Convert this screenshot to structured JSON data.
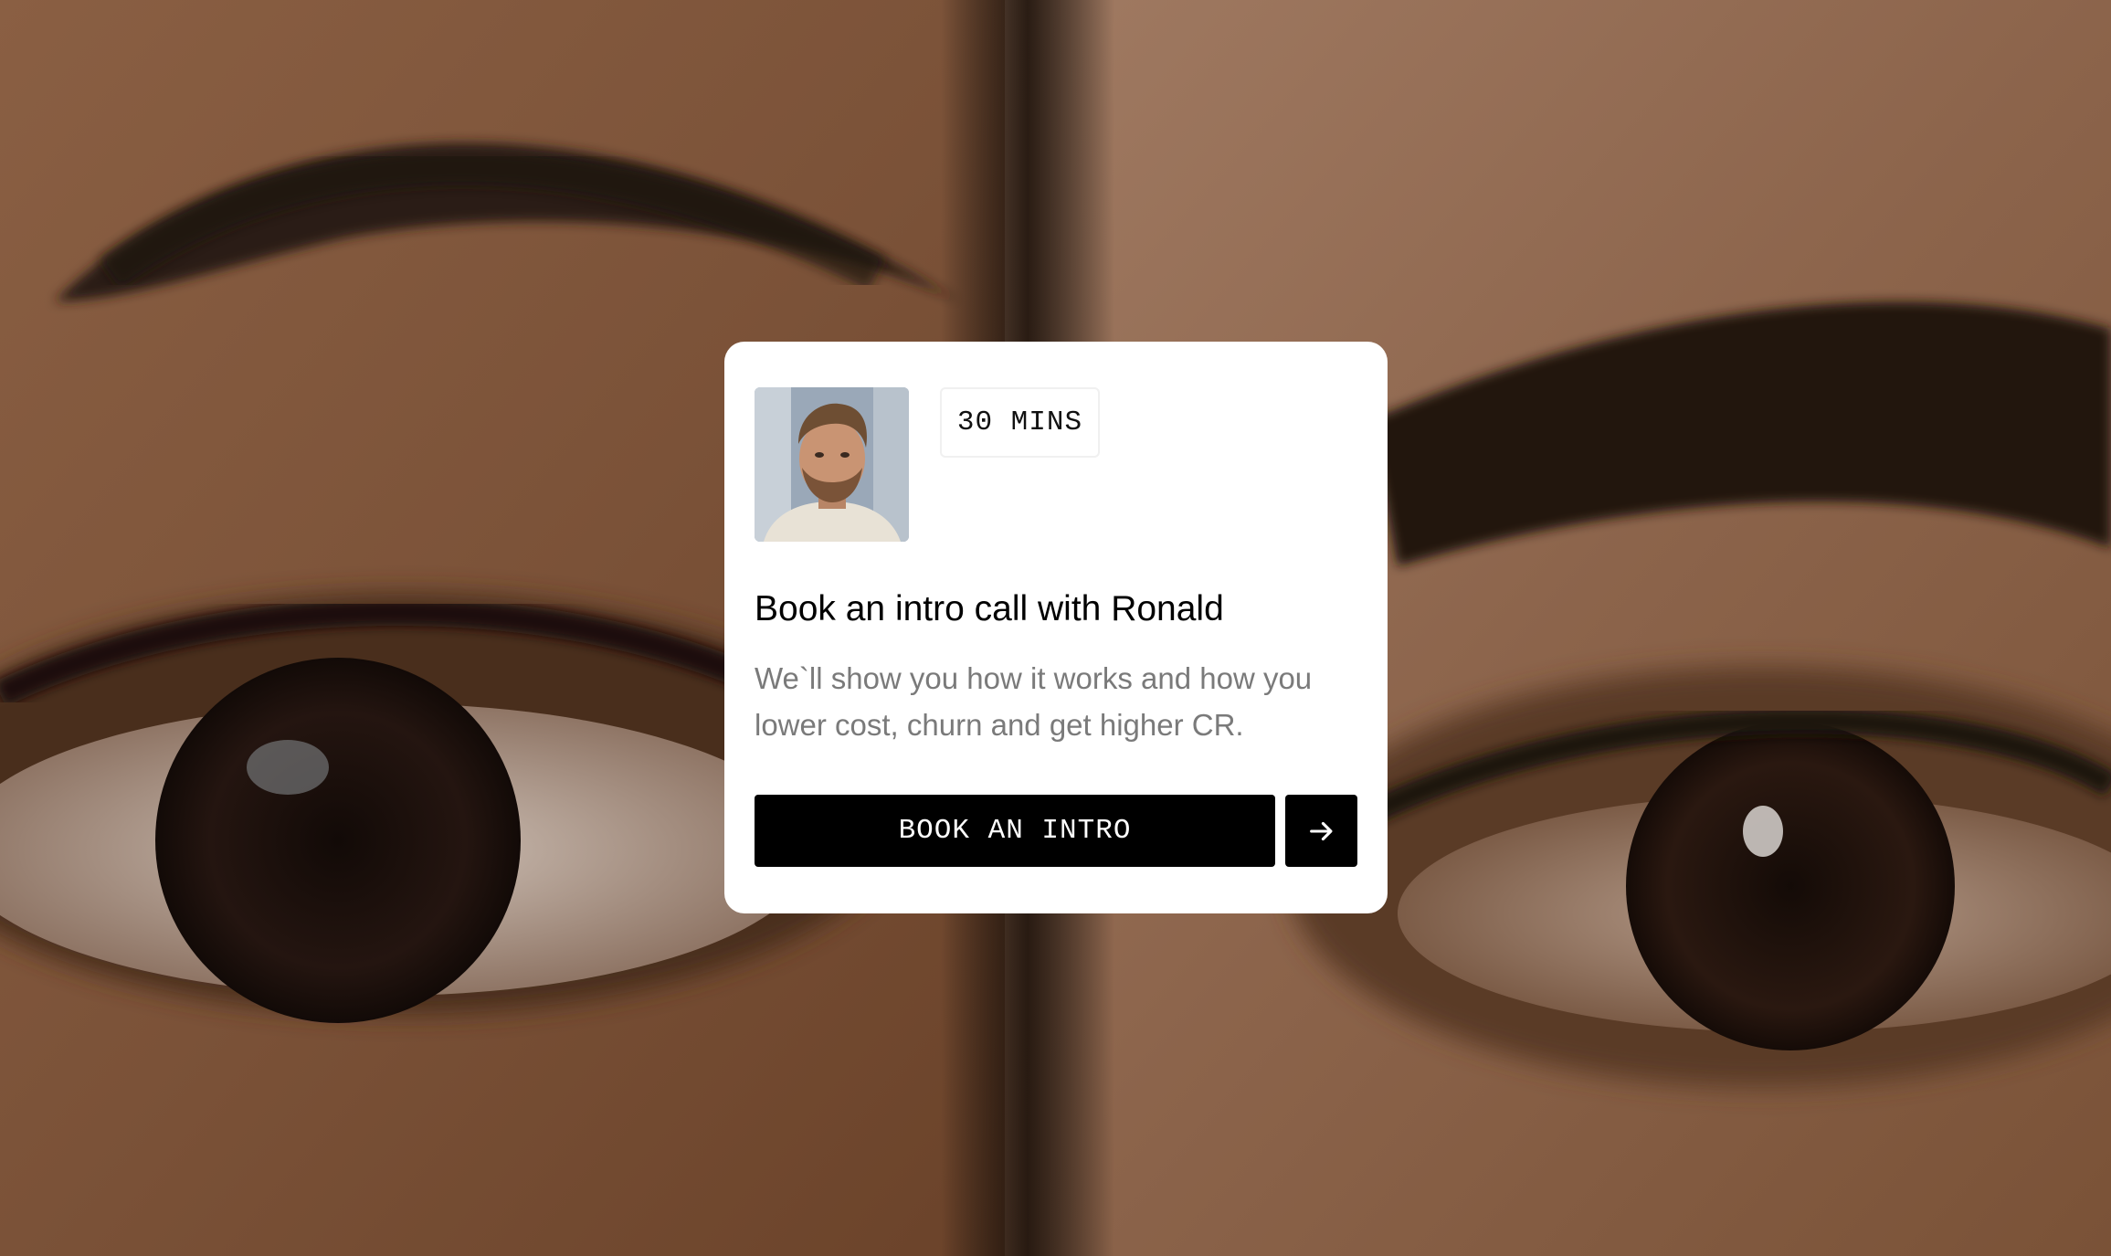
{
  "background": {
    "icon": "eyes-photo"
  },
  "card": {
    "avatar_icon": "person-portrait-icon",
    "duration_label": "30 MINS",
    "title": "Book an intro call with Ronald",
    "description": "We`ll show you how it works and how you lower cost, churn and get higher CR.",
    "cta_label": "BOOK AN INTRO",
    "arrow_icon": "arrow-right-icon"
  },
  "colors": {
    "card_background": "#ffffff",
    "button_background": "#000000",
    "button_text": "#ffffff",
    "title_text": "#000000",
    "description_text": "#7a7a7a"
  }
}
